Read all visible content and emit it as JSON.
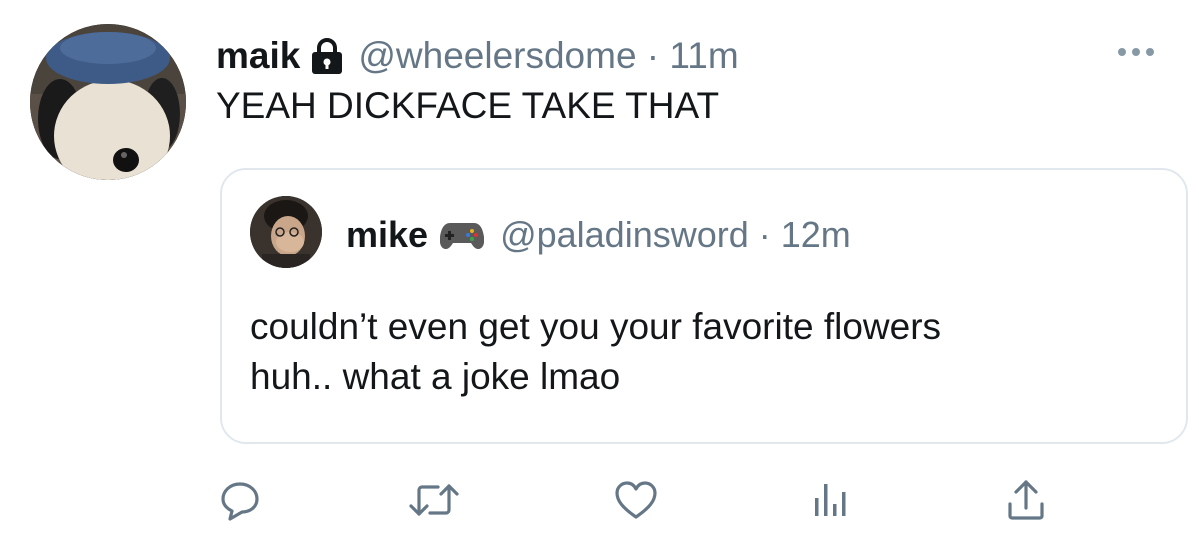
{
  "tweet": {
    "author_name": "maik",
    "handle_time": "@wheelersdome · 11m",
    "text": "YEAH DICKFACE TAKE THAT"
  },
  "quoted_tweet": {
    "author_name": "mike",
    "handle_time": "@paladinsword · 12m",
    "text_lines": [
      "couldn’t even get you your favorite flowers",
      "huh.. what a joke lmao"
    ]
  },
  "icons": {
    "lock": "lock-icon",
    "more": "more-icon",
    "controller": "game-controller-icon",
    "reply": "reply-icon",
    "retweet": "retweet-icon",
    "like": "heart-icon",
    "analytics": "analytics-icon",
    "share": "share-icon"
  },
  "colors": {
    "text": "#14171a",
    "secondary": "#657786",
    "border": "#e1e8ed"
  }
}
